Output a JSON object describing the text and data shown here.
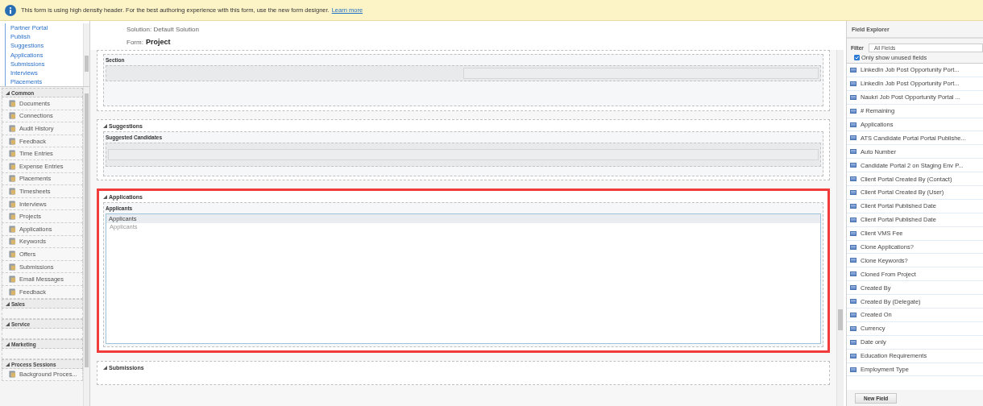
{
  "notification": {
    "text": "This form is using high density header. For the best authoring experience with this form, use the new form designer.",
    "link": "Learn more"
  },
  "nav": {
    "links": [
      "Partner Portal",
      "Publish",
      "Suggestions",
      "Applications",
      "Submissions",
      "Interviews",
      "Placements"
    ],
    "groups": [
      {
        "title": "Common",
        "items": [
          "Documents",
          "Connections",
          "Audit History",
          "Feedback",
          "Time Entries",
          "Expense Entries",
          "Placements",
          "Timesheets",
          "Interviews",
          "Projects",
          "Applications",
          "Keywords",
          "Offers",
          "Submissions",
          "Email Messages",
          "Feedback"
        ]
      },
      {
        "title": "Sales"
      },
      {
        "title": "Service"
      },
      {
        "title": "Marketing"
      },
      {
        "title": "Process Sessions",
        "items": [
          "Background Proces..."
        ]
      }
    ]
  },
  "header": {
    "solution_label": "Solution:",
    "solution": "Default Solution",
    "form_label": "Form:",
    "form": "Project"
  },
  "tabs": [
    {
      "highlighted": false,
      "sections": [
        {
          "kind": "field",
          "title": "Section"
        }
      ]
    },
    {
      "title": "Suggestions",
      "highlighted": false,
      "sections": [
        {
          "kind": "subgrid",
          "title": "Suggested Candidates"
        }
      ]
    },
    {
      "title": "Applications",
      "highlighted": true,
      "sections": [
        {
          "kind": "list",
          "title": "Applicants",
          "list_header": "Applicants",
          "list_hint": "Applicants"
        }
      ]
    },
    {
      "title": "Submissions",
      "highlighted": false
    }
  ],
  "field_explorer": {
    "title": "Field Explorer",
    "filter_label": "Filter",
    "filter_value": "All Fields",
    "unused_only": {
      "label": "Only show unused fields",
      "checked": true
    },
    "fields": [
      "LinkedIn Job Post Opportunity Port...",
      "LinkedIn Job Post Opportunity Port...",
      "Naukri Job Post Opportunity Portal ...",
      "# Remaining",
      "Applications",
      "ATS Candidate Portal Portal Publishe...",
      "Auto Number",
      "Candidate Portal 2 on Staging Env P...",
      "Client Portal Created By (Contact)",
      "Client Portal Created By (User)",
      "Client Portal Published Date",
      "Client Portal Published Date",
      "Client VMS Fee",
      "Clone Applications?",
      "Clone Keywords?",
      "Cloned From Project",
      "Created By",
      "Created By (Delegate)",
      "Created On",
      "Currency",
      "Date only",
      "Education Requirements",
      "Employment Type"
    ],
    "new_field_button": "New Field"
  }
}
